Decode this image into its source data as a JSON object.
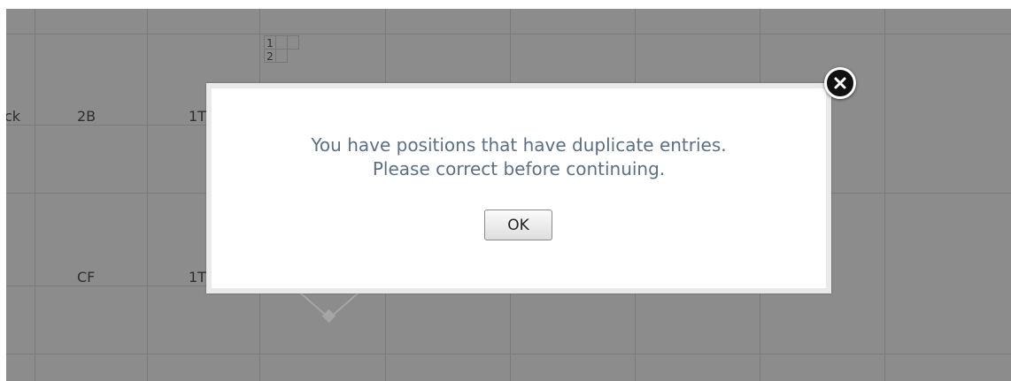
{
  "scorecard": {
    "rows": [
      {
        "player_fragment": "ck",
        "position": "2B",
        "result_fragment": "1T"
      },
      {
        "player_fragment": "",
        "position": "CF",
        "result_fragment": "1T"
      }
    ],
    "inning_numbers": [
      "1",
      "2"
    ]
  },
  "modal": {
    "message_line1": "You have positions that have duplicate entries.",
    "message_line2": "Please correct before continuing.",
    "ok_label": "OK",
    "close_icon": "close-icon"
  },
  "colors": {
    "overlay_gray": "#8c8c8c",
    "message_text": "#5b7085",
    "modal_border": "#e9e9e9"
  }
}
